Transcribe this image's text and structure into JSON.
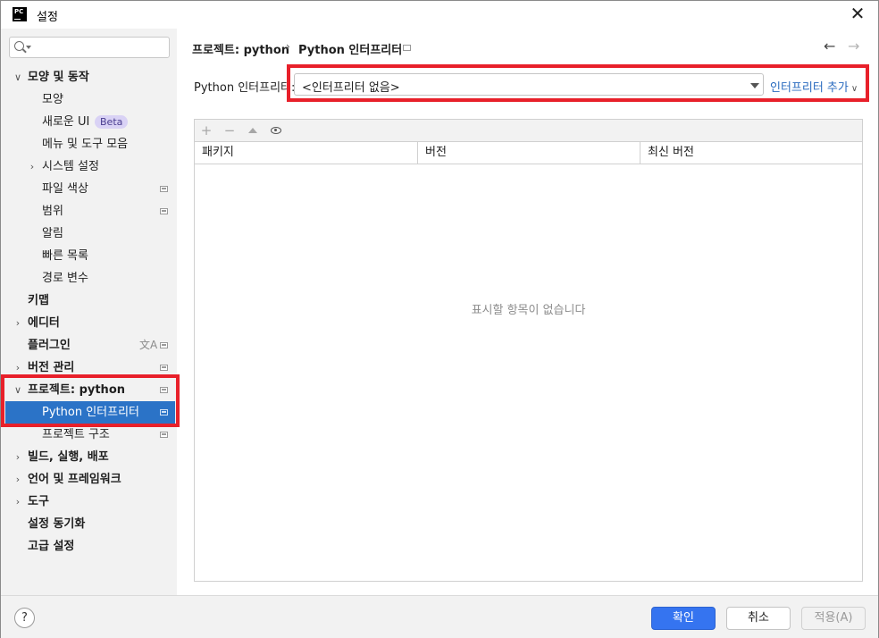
{
  "window": {
    "app_icon_text": "PC",
    "title": "설정",
    "close_glyph": "✕"
  },
  "sidebar": {
    "search": {
      "value": "",
      "placeholder": ""
    },
    "items": [
      {
        "label": "모양 및 동작",
        "chevron": "∨"
      },
      {
        "label": "모양"
      },
      {
        "label": "새로운 UI",
        "badge": "Beta"
      },
      {
        "label": "메뉴 및 도구 모음"
      },
      {
        "label": "시스템 설정",
        "chevron": "›"
      },
      {
        "label": "파일 색상"
      },
      {
        "label": "범위"
      },
      {
        "label": "알림"
      },
      {
        "label": "빠른 목록"
      },
      {
        "label": "경로 변수"
      },
      {
        "label": "키맵"
      },
      {
        "label": "에디터",
        "chevron": "›"
      },
      {
        "label": "플러그인",
        "extra_icon": "文A"
      },
      {
        "label": "버전 관리",
        "chevron": "›"
      },
      {
        "label": "프로젝트: python",
        "chevron": "∨"
      },
      {
        "label": "Python 인터프리터",
        "selected": true
      },
      {
        "label": "프로젝트 구조"
      },
      {
        "label": "빌드, 실행, 배포",
        "chevron": "›"
      },
      {
        "label": "언어 및 프레임워크",
        "chevron": "›"
      },
      {
        "label": "도구",
        "chevron": "›"
      },
      {
        "label": "설정 동기화"
      },
      {
        "label": "고급 설정"
      }
    ]
  },
  "breadcrumb": {
    "parent": "프로젝트: python",
    "separator": "›",
    "current": "Python 인터프리터",
    "back_glyph": "←",
    "forward_glyph": "→"
  },
  "interpreter": {
    "label": "Python 인터프리터:",
    "selected": "<인터프리터 없음>",
    "add_link": "인터프리터 추가",
    "add_chevron": "∨"
  },
  "packages": {
    "toolbar": {
      "add": "+",
      "remove": "−"
    },
    "columns": [
      "패키지",
      "버전",
      "최신 버전"
    ],
    "rows": [],
    "empty_text": "표시할 항목이 없습니다"
  },
  "footer": {
    "help": "?",
    "ok": "확인",
    "cancel": "취소",
    "apply": "적용(A)"
  },
  "colors": {
    "selection": "#2b73c7",
    "primary_button": "#3574f0",
    "link": "#2a6bbf",
    "highlight_box": "#e8202a",
    "beta_badge_bg": "#d9d2f5"
  }
}
